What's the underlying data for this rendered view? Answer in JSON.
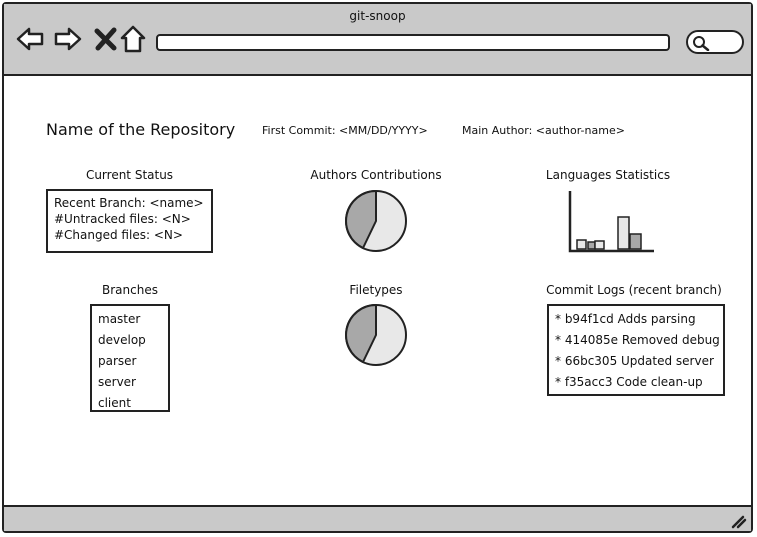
{
  "window": {
    "title": "git-snoop"
  },
  "toolbar": {
    "back_icon": "back-arrow-icon",
    "forward_icon": "forward-arrow-icon",
    "stop_icon": "close-icon",
    "home_icon": "home-icon",
    "search_icon": "search-icon"
  },
  "repo": {
    "name": "Name of the Repository",
    "first_commit": "First Commit: <MM/DD/YYYY>",
    "main_author": "Main Author: <author-name>"
  },
  "current_status": {
    "heading": "Current Status",
    "lines": [
      "Recent Branch: <name>",
      "#Untracked files: <N>",
      "#Changed files: <N>"
    ]
  },
  "authors": {
    "heading": "Authors Contributions"
  },
  "languages": {
    "heading": "Languages Statistics"
  },
  "branches": {
    "heading": "Branches",
    "items": [
      "master",
      "develop",
      "parser",
      "server",
      "client"
    ]
  },
  "filetypes": {
    "heading": "Filetypes"
  },
  "commit_logs": {
    "heading": "Commit Logs (recent branch)",
    "items": [
      "* b94f1cd Adds parsing",
      "* 414085e Removed debug",
      "* 66bc305 Updated server",
      "* f35acc3 Code clean-up"
    ]
  },
  "colors": {
    "chrome": "#c9c9c9",
    "stroke": "#222222",
    "pie_dark": "#a8a8a8",
    "pie_light": "#e8e8e8"
  }
}
